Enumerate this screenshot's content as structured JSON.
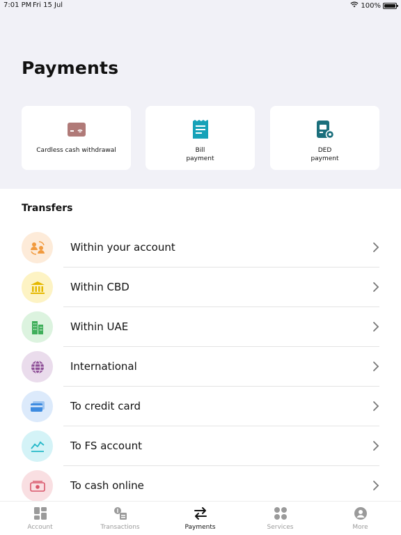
{
  "status_bar": {
    "time": "7:01 PM",
    "date": "Fri 15 Jul",
    "battery": "100%",
    "battery_level": 1.0
  },
  "page": {
    "title": "Payments"
  },
  "quick_actions": [
    {
      "label": "Cardless cash withdrawal",
      "icon": "cardless-cash-icon",
      "color": "#b07a78"
    },
    {
      "label": "Bill\npayment",
      "icon": "bill-icon",
      "color": "#17a2b8"
    },
    {
      "label": "DED\npayment",
      "icon": "ded-icon",
      "color": "#1b6f7c"
    }
  ],
  "transfers": {
    "title": "Transfers",
    "items": [
      {
        "label": "Within your account",
        "icon": "people-exchange-icon",
        "bg": "#fdebd9",
        "fg": "#f19a3e"
      },
      {
        "label": "Within CBD",
        "icon": "bank-icon",
        "bg": "#fdf3c4",
        "fg": "#e5b800"
      },
      {
        "label": "Within UAE",
        "icon": "buildings-icon",
        "bg": "#dcf3df",
        "fg": "#3fae5a"
      },
      {
        "label": "International",
        "icon": "globe-icon",
        "bg": "#eadcec",
        "fg": "#8e4f97"
      },
      {
        "label": "To credit card",
        "icon": "credit-card-icon",
        "bg": "#dceafb",
        "fg": "#3d8be0"
      },
      {
        "label": "To FS account",
        "icon": "chart-icon",
        "bg": "#d4f3f7",
        "fg": "#27b8c9"
      },
      {
        "label": "To cash online",
        "icon": "cash-icon",
        "bg": "#f9dfe2",
        "fg": "#d9566a"
      }
    ]
  },
  "tab_bar": {
    "active": "Payments",
    "tabs": [
      {
        "label": "Account",
        "icon": "account-grid-icon"
      },
      {
        "label": "Transactions",
        "icon": "transactions-icon"
      },
      {
        "label": "Payments",
        "icon": "payments-arrows-icon"
      },
      {
        "label": "Services",
        "icon": "services-dots-icon"
      },
      {
        "label": "More",
        "icon": "more-profile-icon"
      }
    ]
  }
}
